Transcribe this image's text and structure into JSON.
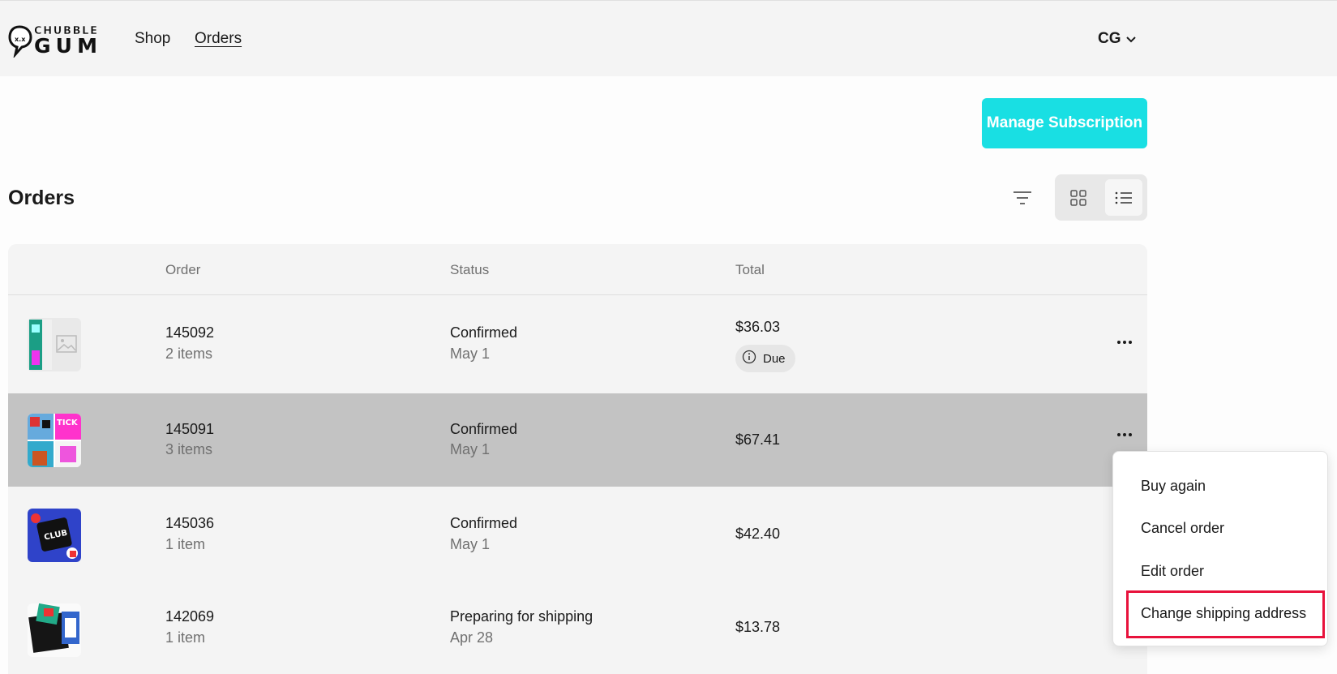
{
  "header": {
    "logo_text": "CHUBBLE GUM",
    "nav": [
      {
        "label": "Shop"
      },
      {
        "label": "Orders"
      }
    ],
    "account_initials": "CG"
  },
  "actions": {
    "manage_subscription": "Manage Subscription"
  },
  "orders": {
    "title": "Orders",
    "columns": [
      "Order",
      "Status",
      "Total"
    ],
    "rows": [
      {
        "number": "145092",
        "items": "2 items",
        "status": "Confirmed",
        "date": "May 1",
        "total": "$36.03",
        "badge": "Due"
      },
      {
        "number": "145091",
        "items": "3 items",
        "status": "Confirmed",
        "date": "May 1",
        "total": "$67.41"
      },
      {
        "number": "145036",
        "items": "1 item",
        "status": "Confirmed",
        "date": "May 1",
        "total": "$42.40"
      },
      {
        "number": "142069",
        "items": "1 item",
        "status": "Preparing for shipping",
        "date": "Apr 28",
        "total": "$13.78"
      }
    ]
  },
  "context_menu": {
    "items": [
      {
        "label": "Buy again"
      },
      {
        "label": "Cancel order"
      },
      {
        "label": "Edit order"
      },
      {
        "label": "Change shipping address"
      }
    ],
    "highlight_color": "#e8123c"
  },
  "colors": {
    "accent": "#19dfe3",
    "highlight_row": "#c3c3c3"
  }
}
